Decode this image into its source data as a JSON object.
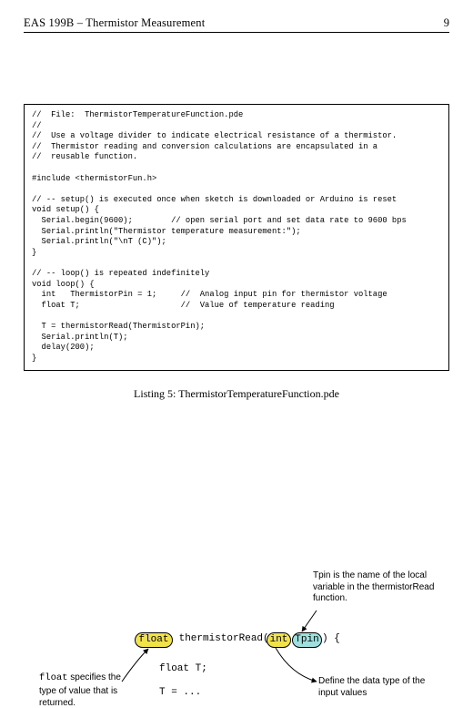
{
  "header": {
    "title": "EAS 199B – Thermistor Measurement",
    "page_number": "9"
  },
  "code_listing": "//  File:  ThermistorTemperatureFunction.pde\n//\n//  Use a voltage divider to indicate electrical resistance of a thermistor.\n//  Thermistor reading and conversion calculations are encapsulated in a\n//  reusable function.\n\n#include <thermistorFun.h>\n\n// -- setup() is executed once when sketch is downloaded or Arduino is reset\nvoid setup() {\n  Serial.begin(9600);        // open serial port and set data rate to 9600 bps\n  Serial.println(\"Thermistor temperature measurement:\");\n  Serial.println(\"\\nT (C)\");\n}\n\n// -- loop() is repeated indefinitely\nvoid loop() {\n  int   ThermistorPin = 1;     //  Analog input pin for thermistor voltage\n  float T;                     //  Value of temperature reading\n\n  T = thermistorRead(ThermistorPin);\n  Serial.println(T);\n  delay(200);\n}",
  "caption": "Listing 5: ThermistorTemperatureFunction.pde",
  "diagram": {
    "note_tpin": "Tpin is the name of the\nlocal variable in the\nthermistorRead function.",
    "note_define": "Define the data type\nof the input values",
    "note_float_label": "float",
    "note_float_rest": " specifies\nthe type of value\nthat is returned.",
    "bubble_float": "float",
    "bubble_int": "int",
    "bubble_tpin": "Tpin",
    "sig_mid": " thermistorRead(",
    "sig_after_int": " ",
    "sig_close": ") {",
    "body1": "float T;",
    "body2": "T = ..."
  }
}
